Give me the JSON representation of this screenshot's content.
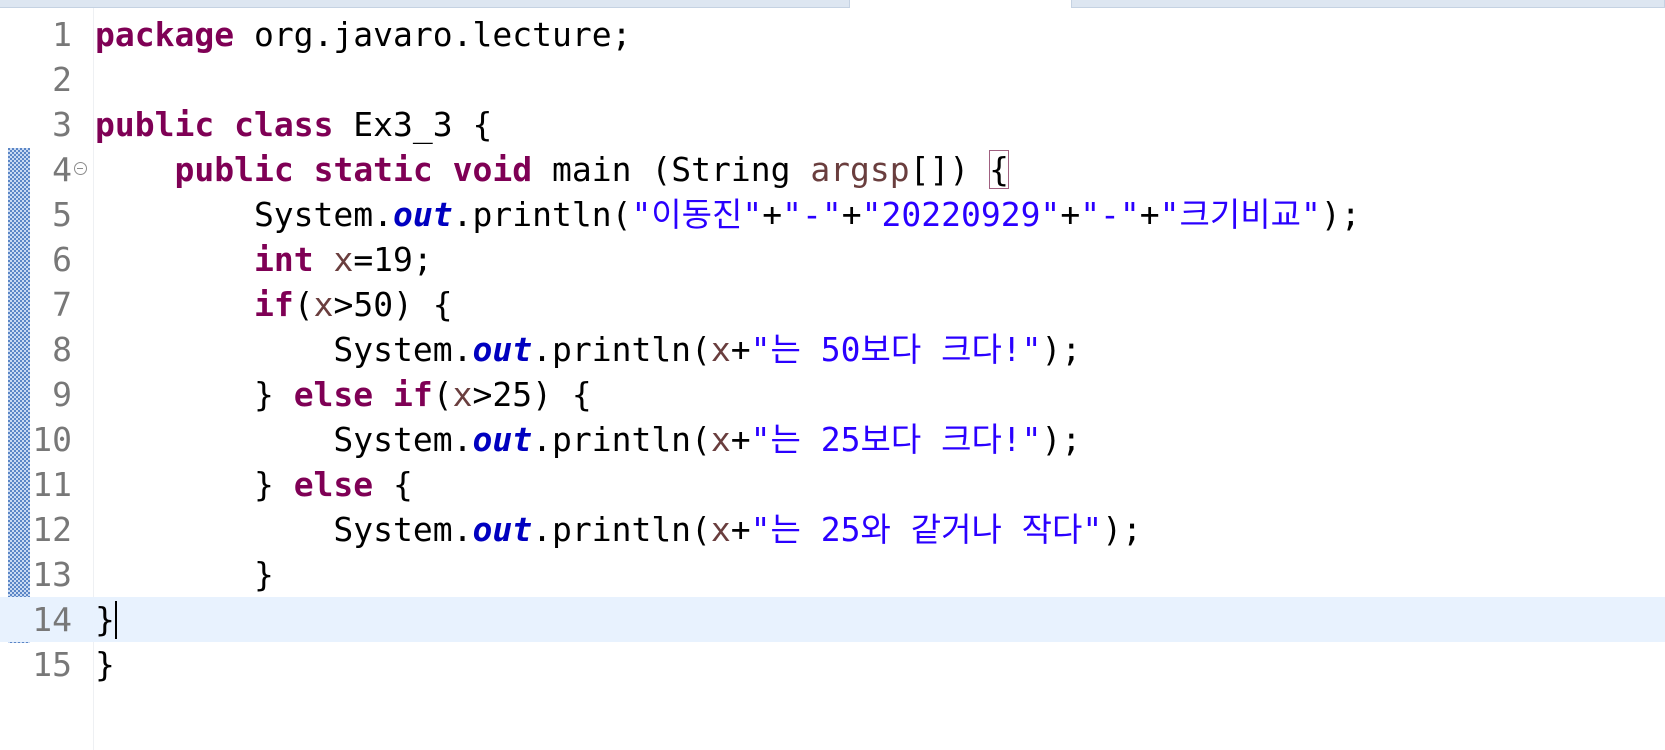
{
  "editor": {
    "language": "java",
    "current_line": 14,
    "lines": [
      {
        "n": "1",
        "tokens": [
          {
            "t": "kw",
            "v": "package"
          },
          {
            "t": "p",
            "v": " org.javaro.lecture;"
          }
        ]
      },
      {
        "n": "2",
        "tokens": []
      },
      {
        "n": "3",
        "tokens": [
          {
            "t": "kw",
            "v": "public"
          },
          {
            "t": "p",
            "v": " "
          },
          {
            "t": "kw",
            "v": "class"
          },
          {
            "t": "p",
            "v": " Ex3_3 {"
          }
        ]
      },
      {
        "n": "4",
        "fold": true,
        "tokens": [
          {
            "t": "p",
            "v": "    "
          },
          {
            "t": "kw",
            "v": "public"
          },
          {
            "t": "p",
            "v": " "
          },
          {
            "t": "kw",
            "v": "static"
          },
          {
            "t": "p",
            "v": " "
          },
          {
            "t": "kw",
            "v": "void"
          },
          {
            "t": "p",
            "v": " main (String "
          },
          {
            "t": "var",
            "v": "argsp"
          },
          {
            "t": "p",
            "v": "[]) "
          },
          {
            "t": "bm",
            "v": "{"
          }
        ]
      },
      {
        "n": "5",
        "tokens": [
          {
            "t": "p",
            "v": "        System."
          },
          {
            "t": "fld",
            "v": "out"
          },
          {
            "t": "p",
            "v": ".println("
          },
          {
            "t": "str",
            "v": "\"이동진\""
          },
          {
            "t": "p",
            "v": "+"
          },
          {
            "t": "str",
            "v": "\"-\""
          },
          {
            "t": "p",
            "v": "+"
          },
          {
            "t": "str",
            "v": "\"20220929\""
          },
          {
            "t": "p",
            "v": "+"
          },
          {
            "t": "str",
            "v": "\"-\""
          },
          {
            "t": "p",
            "v": "+"
          },
          {
            "t": "str",
            "v": "\"크기비교\""
          },
          {
            "t": "p",
            "v": ");"
          }
        ]
      },
      {
        "n": "6",
        "tokens": [
          {
            "t": "p",
            "v": "        "
          },
          {
            "t": "kw",
            "v": "int"
          },
          {
            "t": "p",
            "v": " "
          },
          {
            "t": "var",
            "v": "x"
          },
          {
            "t": "p",
            "v": "=19;"
          }
        ]
      },
      {
        "n": "7",
        "tokens": [
          {
            "t": "p",
            "v": "        "
          },
          {
            "t": "kw",
            "v": "if"
          },
          {
            "t": "p",
            "v": "("
          },
          {
            "t": "var",
            "v": "x"
          },
          {
            "t": "p",
            "v": ">50) {"
          }
        ]
      },
      {
        "n": "8",
        "tokens": [
          {
            "t": "p",
            "v": "            System."
          },
          {
            "t": "fld",
            "v": "out"
          },
          {
            "t": "p",
            "v": ".println("
          },
          {
            "t": "var",
            "v": "x"
          },
          {
            "t": "p",
            "v": "+"
          },
          {
            "t": "str",
            "v": "\"는 50보다 크다!\""
          },
          {
            "t": "p",
            "v": ");"
          }
        ]
      },
      {
        "n": "9",
        "tokens": [
          {
            "t": "p",
            "v": "        } "
          },
          {
            "t": "kw",
            "v": "else"
          },
          {
            "t": "p",
            "v": " "
          },
          {
            "t": "kw",
            "v": "if"
          },
          {
            "t": "p",
            "v": "("
          },
          {
            "t": "var",
            "v": "x"
          },
          {
            "t": "p",
            "v": ">25) {"
          }
        ]
      },
      {
        "n": "10",
        "tokens": [
          {
            "t": "p",
            "v": "            System."
          },
          {
            "t": "fld",
            "v": "out"
          },
          {
            "t": "p",
            "v": ".println("
          },
          {
            "t": "var",
            "v": "x"
          },
          {
            "t": "p",
            "v": "+"
          },
          {
            "t": "str",
            "v": "\"는 25보다 크다!\""
          },
          {
            "t": "p",
            "v": ");"
          }
        ]
      },
      {
        "n": "11",
        "tokens": [
          {
            "t": "p",
            "v": "        } "
          },
          {
            "t": "kw",
            "v": "else"
          },
          {
            "t": "p",
            "v": " {"
          }
        ]
      },
      {
        "n": "12",
        "tokens": [
          {
            "t": "p",
            "v": "            System."
          },
          {
            "t": "fld",
            "v": "out"
          },
          {
            "t": "p",
            "v": ".println("
          },
          {
            "t": "var",
            "v": "x"
          },
          {
            "t": "p",
            "v": "+"
          },
          {
            "t": "str",
            "v": "\"는 25와 같거나 작다\""
          },
          {
            "t": "p",
            "v": ");"
          }
        ]
      },
      {
        "n": "13",
        "tokens": [
          {
            "t": "p",
            "v": "        }"
          }
        ]
      },
      {
        "n": "14",
        "caret": true,
        "tokens": [
          {
            "t": "p",
            "v": "}"
          }
        ]
      },
      {
        "n": "15",
        "tokens": [
          {
            "t": "p",
            "v": "}"
          }
        ]
      }
    ]
  },
  "colors": {
    "keyword": "#7f0055",
    "static_field": "#0000c0",
    "string": "#2a00ff",
    "local_variable": "#6a3e3e",
    "line_number": "#787878",
    "current_line_highlight": "#e8f2fe",
    "change_bar": "#5b86c6"
  }
}
